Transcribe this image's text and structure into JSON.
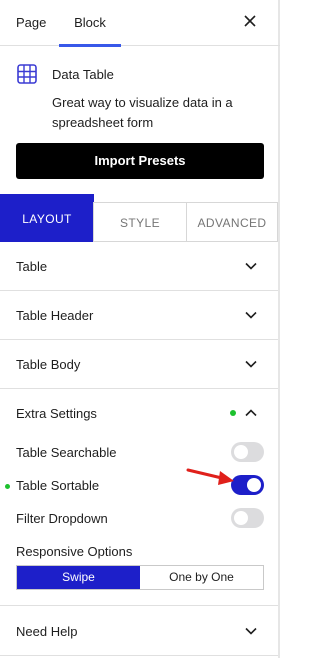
{
  "header": {
    "tabs": [
      {
        "label": "Page"
      },
      {
        "label": "Block"
      }
    ]
  },
  "block": {
    "title": "Data Table",
    "description": "Great way to visualize data in a spreadsheet form",
    "import_label": "Import Presets"
  },
  "panel_tabs": [
    {
      "label": "LAYOUT"
    },
    {
      "label": "STYLE"
    },
    {
      "label": "ADVANCED"
    }
  ],
  "sections": {
    "table": "Table",
    "table_header": "Table Header",
    "table_body": "Table Body",
    "extra_settings": "Extra Settings",
    "need_help": "Need Help"
  },
  "extra": {
    "searchable": {
      "label": "Table Searchable",
      "enabled": false
    },
    "sortable": {
      "label": "Table Sortable",
      "enabled": true
    },
    "filter": {
      "label": "Filter Dropdown",
      "enabled": false
    },
    "responsive_label": "Responsive Options",
    "responsive_options": [
      {
        "label": "Swipe",
        "selected": true
      },
      {
        "label": "One by One",
        "selected": false
      }
    ]
  },
  "colors": {
    "accent": "#1d1fc9",
    "tab_underline": "#3858e9",
    "modified_dot": "#1dc12e",
    "annotation_arrow": "#e0201b"
  }
}
